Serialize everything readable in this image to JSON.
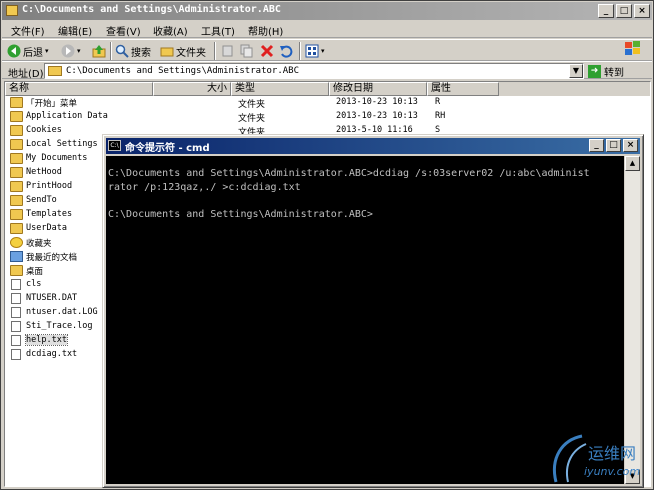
{
  "window": {
    "title": "C:\\Documents and Settings\\Administrator.ABC",
    "minimize": "_",
    "maximize": "□",
    "close": "×"
  },
  "menu": [
    "文件(F)",
    "编辑(E)",
    "查看(V)",
    "收藏(A)",
    "工具(T)",
    "帮助(H)"
  ],
  "toolbar": {
    "back": "后退",
    "search": "搜索",
    "folders": "文件夹"
  },
  "address": {
    "label": "地址(D)",
    "value": "C:\\Documents and Settings\\Administrator.ABC",
    "go": "转到"
  },
  "columns": {
    "name": "名称",
    "size": "大小",
    "type": "类型",
    "modified": "修改日期",
    "attributes": "属性"
  },
  "files": [
    {
      "name": "「开始」菜单",
      "icon": "folder-icon",
      "type": "文件夹",
      "date": "2013-10-23 10:13",
      "attr": "R"
    },
    {
      "name": "Application Data",
      "icon": "folder-icon",
      "type": "文件夹",
      "date": "2013-10-23 10:13",
      "attr": "RH"
    },
    {
      "name": "Cookies",
      "icon": "folder-icon",
      "type": "文件夹",
      "date": "2013-5-10 11:16",
      "attr": "S"
    },
    {
      "name": "Local Settings",
      "icon": "folder-icon"
    },
    {
      "name": "My Documents",
      "icon": "folder-icon"
    },
    {
      "name": "NetHood",
      "icon": "folder-icon"
    },
    {
      "name": "PrintHood",
      "icon": "folder-icon"
    },
    {
      "name": "SendTo",
      "icon": "folder-icon"
    },
    {
      "name": "Templates",
      "icon": "folder-icon"
    },
    {
      "name": "UserData",
      "icon": "folder-icon"
    },
    {
      "name": "收藏夹",
      "icon": "favorites-star-icon"
    },
    {
      "name": "我最近的文档",
      "icon": "recent-docs-icon"
    },
    {
      "name": "桌面",
      "icon": "folder-icon"
    },
    {
      "name": "cls",
      "icon": "file-icon"
    },
    {
      "name": "NTUSER.DAT",
      "icon": "file-icon"
    },
    {
      "name": "ntuser.dat.LOG",
      "icon": "file-icon"
    },
    {
      "name": "Sti_Trace.log",
      "icon": "file-icon"
    },
    {
      "name": "help.txt",
      "icon": "text-file-icon",
      "selected": true
    },
    {
      "name": "dcdiag.txt",
      "icon": "text-file-icon"
    }
  ],
  "cmd": {
    "title": "命令提示符 - cmd",
    "icon_text": "C:\\",
    "lines": [
      "C:\\Documents and Settings\\Administrator.ABC>dcdiag /s:03server02 /u:abc\\administ",
      "rator /p:123qaz,./ >c:dcdiag.txt",
      "",
      "C:\\Documents and Settings\\Administrator.ABC>"
    ]
  },
  "watermark": {
    "cn": "运维网",
    "en": "iyunv.com"
  }
}
